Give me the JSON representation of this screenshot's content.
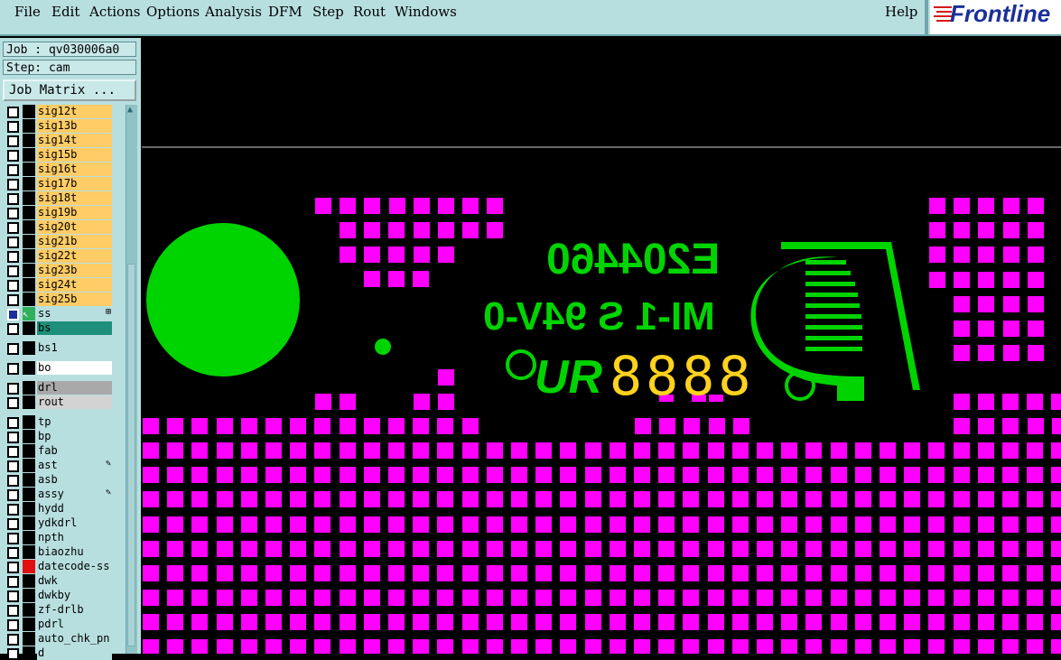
{
  "menubar": {
    "items": [
      "File",
      "Edit",
      "Actions",
      "Options",
      "Analysis",
      "DFM",
      "Step",
      "Rout",
      "Windows"
    ],
    "help": "Help"
  },
  "brand": "Frontline",
  "job": "Job : qv030006a0",
  "step": "Step: cam",
  "job_matrix_button": "Job Matrix ...",
  "layers": [
    {
      "name": "sig12t",
      "color": "#ffcc66"
    },
    {
      "name": "sig13b",
      "color": "#ffcc66"
    },
    {
      "name": "sig14t",
      "color": "#ffcc66"
    },
    {
      "name": "sig15b",
      "color": "#ffcc66"
    },
    {
      "name": "sig16t",
      "color": "#ffcc66"
    },
    {
      "name": "sig17b",
      "color": "#ffcc66"
    },
    {
      "name": "sig18t",
      "color": "#ffcc66"
    },
    {
      "name": "sig19b",
      "color": "#ffcc66"
    },
    {
      "name": "sig20t",
      "color": "#ffcc66"
    },
    {
      "name": "sig21b",
      "color": "#ffcc66"
    },
    {
      "name": "sig22t",
      "color": "#ffcc66"
    },
    {
      "name": "sig23b",
      "color": "#ffcc66"
    },
    {
      "name": "sig24t",
      "color": "#ffcc66"
    },
    {
      "name": "sig25b",
      "color": "#ffcc66"
    },
    {
      "name": "ss",
      "color": "#b8dfe0",
      "active": true
    },
    {
      "name": "bs",
      "color": "#1e8f7a"
    },
    {
      "name": "bs1",
      "color": "#b8dfe0"
    },
    {
      "name": "bo",
      "color": "#ffffff"
    },
    {
      "name": "drl",
      "color": "#a9a9a9"
    },
    {
      "name": "rout",
      "color": "#d3d3d3"
    },
    {
      "name": "tp",
      "color": "#b8dfe0"
    },
    {
      "name": "bp",
      "color": "#b8dfe0"
    },
    {
      "name": "fab",
      "color": "#b8dfe0"
    },
    {
      "name": "ast",
      "color": "#b8dfe0",
      "icon": "edit-pen-icon"
    },
    {
      "name": "asb",
      "color": "#b8dfe0"
    },
    {
      "name": "assy",
      "color": "#b8dfe0",
      "icon": "edit-pen-icon"
    },
    {
      "name": "hydd",
      "color": "#b8dfe0"
    },
    {
      "name": "ydkdrl",
      "color": "#b8dfe0"
    },
    {
      "name": "npth",
      "color": "#b8dfe0"
    },
    {
      "name": "biaozhu",
      "color": "#b8dfe0"
    },
    {
      "name": "datecode-ss",
      "color": "#b8dfe0",
      "red": true
    },
    {
      "name": "dwk",
      "color": "#b8dfe0"
    },
    {
      "name": "dwkby",
      "color": "#b8dfe0"
    },
    {
      "name": "zf-drlb",
      "color": "#b8dfe0"
    },
    {
      "name": "pdrl",
      "color": "#b8dfe0"
    },
    {
      "name": "auto_chk_pn",
      "color": "#b8dfe0"
    },
    {
      "name": "d",
      "color": "#b8dfe0"
    }
  ],
  "silkscreen": {
    "line1": "E204460",
    "line2": "MI-1 S 94V-0",
    "mark": "UR",
    "digits": "8888",
    "green": "#00d400",
    "pad": "#ff00ff"
  }
}
